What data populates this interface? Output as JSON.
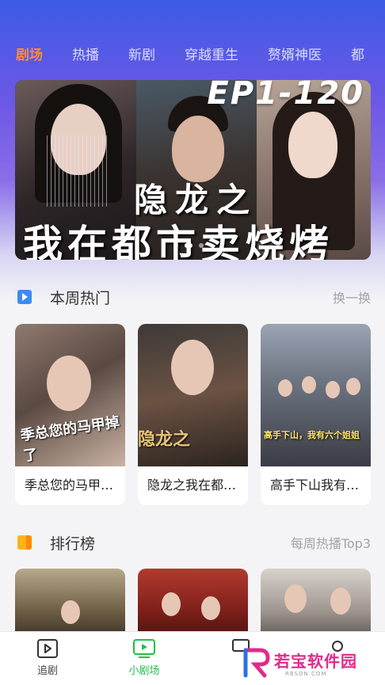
{
  "tabs": [
    {
      "label": "剧场",
      "active": true
    },
    {
      "label": "热播",
      "active": false
    },
    {
      "label": "新剧",
      "active": false
    },
    {
      "label": "穿越重生",
      "active": false
    },
    {
      "label": "赘婿神医",
      "active": false
    },
    {
      "label": "都",
      "active": false
    }
  ],
  "banner": {
    "episode_text": "EP1-120",
    "title_line1": "隐龙之",
    "title_line2": "我在都市卖烧烤",
    "dot_count": 3,
    "active_dot": 1
  },
  "weekly_hot": {
    "title": "本周热门",
    "action_label": "换一换",
    "icon": "play-icon",
    "cards": [
      {
        "caption": "季总您的马甲掉了",
        "poster_text": "季总您的马甲掉了"
      },
      {
        "caption": "隐龙之我在都市卖烧烤",
        "poster_text": "隐龙之"
      },
      {
        "caption": "高手下山我有六个姐姐",
        "poster_text": "高手下山，我有六个姐姐"
      }
    ]
  },
  "ranking": {
    "title": "排行榜",
    "action_label": "每周热播Top3",
    "icon": "bookmark-icon"
  },
  "bottom_nav": [
    {
      "label": "追剧",
      "icon": "play-box-icon",
      "active": false
    },
    {
      "label": "小剧场",
      "icon": "tv-icon",
      "active": true
    }
  ],
  "watermark": {
    "text": "若宝软件园",
    "sub": "RBSON.COM"
  },
  "colors": {
    "accent_active_tab": "#ff8a3c",
    "nav_active": "#1fbf4d",
    "header_gradient_top": "#3d5be6",
    "header_gradient_mid": "#8a6ee8"
  }
}
